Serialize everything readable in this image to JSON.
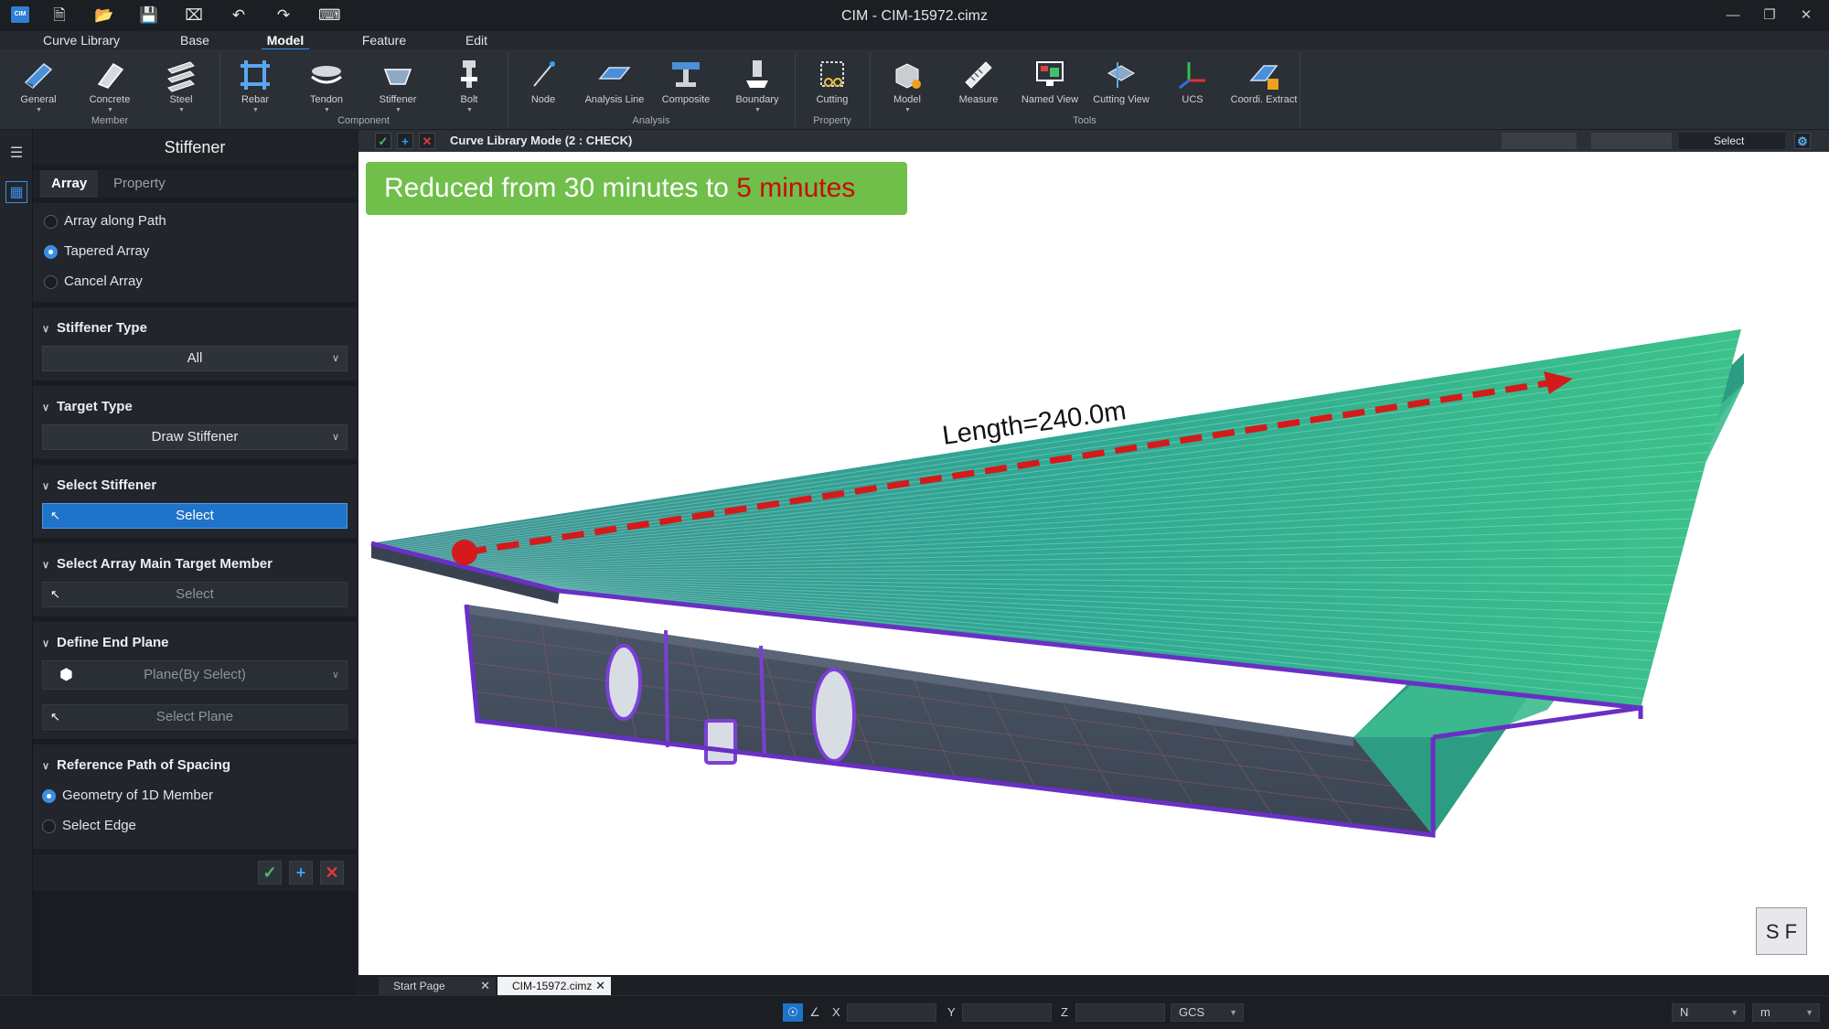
{
  "window": {
    "title": "CIM - CIM-15972.cimz",
    "logo": "CIM"
  },
  "quick_access": [
    "new-file-icon",
    "open-folder-icon",
    "save-icon",
    "close-file-icon",
    "undo-icon",
    "redo-icon",
    "keyboard-icon"
  ],
  "menu": {
    "tabs": [
      "Curve Library",
      "Base",
      "Model",
      "Feature",
      "Edit"
    ],
    "active": "Model"
  },
  "ribbon": {
    "buttons": [
      {
        "label": "General",
        "icon": "general-member-icon"
      },
      {
        "label": "Concrete",
        "icon": "concrete-icon"
      },
      {
        "label": "Steel",
        "icon": "steel-icon"
      },
      {
        "label": "Rebar",
        "icon": "rebar-icon"
      },
      {
        "label": "Tendon",
        "icon": "tendon-icon"
      },
      {
        "label": "Stiffener",
        "icon": "stiffener-icon"
      },
      {
        "label": "Bolt",
        "icon": "bolt-icon"
      },
      {
        "label": "Node",
        "icon": "node-icon"
      },
      {
        "label": "Analysis Line",
        "icon": "analysis-line-icon"
      },
      {
        "label": "Composite",
        "icon": "composite-icon"
      },
      {
        "label": "Boundary",
        "icon": "boundary-icon"
      },
      {
        "label": "Cutting",
        "icon": "cutting-icon"
      },
      {
        "label": "Model",
        "icon": "model-icon"
      },
      {
        "label": "Measure",
        "icon": "measure-icon"
      },
      {
        "label": "Named View",
        "icon": "named-view-icon"
      },
      {
        "label": "Cutting View",
        "icon": "cutting-view-icon"
      },
      {
        "label": "UCS",
        "icon": "ucs-icon"
      },
      {
        "label": "Coordi. Extract",
        "icon": "coordinate-extract-icon"
      }
    ],
    "groups": [
      "Member",
      "Component",
      "Analysis",
      "Property",
      "Tools"
    ]
  },
  "panel": {
    "title": "Stiffener",
    "tabs": [
      "Array",
      "Property"
    ],
    "array_options": [
      "Array along Path",
      "Tapered Array",
      "Cancel Array"
    ],
    "array_selected": "Tapered Array",
    "stiffener_type": {
      "header": "Stiffener Type",
      "value": "All"
    },
    "target_type": {
      "header": "Target Type",
      "value": "Draw Stiffener"
    },
    "select_stiffener": {
      "header": "Select Stiffener",
      "button": "Select"
    },
    "select_main_target": {
      "header": "Select Array Main Target Member",
      "button": "Select"
    },
    "end_plane": {
      "header": "Define End Plane",
      "dropdown": "Plane(By Select)",
      "button": "Select Plane"
    },
    "reference_path": {
      "header": "Reference Path of Spacing",
      "options": [
        "Geometry of 1D Member",
        "Select Edge"
      ],
      "selected": "Geometry of 1D Member"
    }
  },
  "viewport": {
    "mode_label": "Curve Library Mode (2 : CHECK)",
    "select_label": "Select",
    "banner": {
      "prefix": "Reduced from 30 minutes to ",
      "highlight": "5 minutes"
    },
    "measure_label": "Length=240.0m",
    "viewcube": {
      "left": "S",
      "right": "F"
    },
    "colors": {
      "banner_bg": "#6fbf4a",
      "highlight": "#c90c0c",
      "arrow": "#d41a1a",
      "edge": "#6a2fc4"
    }
  },
  "doc_tabs": [
    {
      "label": "Start Page"
    },
    {
      "label": "CIM-15972.cimz",
      "active": true
    }
  ],
  "status": {
    "x_label": "X",
    "y_label": "Y",
    "z_label": "Z",
    "coord_system": "GCS",
    "force_unit": "N",
    "length_unit": "m"
  }
}
